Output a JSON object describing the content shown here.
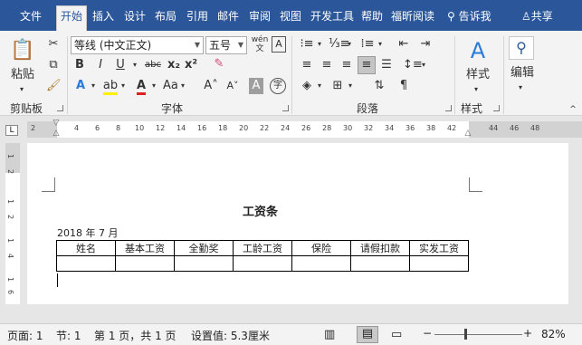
{
  "tabs": [
    {
      "label": "文件",
      "active": false
    },
    {
      "label": "开始",
      "active": true
    },
    {
      "label": "插入",
      "active": false
    },
    {
      "label": "设计",
      "active": false
    },
    {
      "label": "布局",
      "active": false
    },
    {
      "label": "引用",
      "active": false
    },
    {
      "label": "邮件",
      "active": false
    },
    {
      "label": "审阅",
      "active": false
    },
    {
      "label": "视图",
      "active": false
    },
    {
      "label": "开发工具",
      "active": false
    },
    {
      "label": "帮助",
      "active": false
    },
    {
      "label": "福昕阅读",
      "active": false
    }
  ],
  "tell_me": "告诉我",
  "share": "共享",
  "ribbon": {
    "clipboard": {
      "paste": "粘贴",
      "group": "剪贴板"
    },
    "font": {
      "family": "等线 (中文正文)",
      "size": "五号",
      "group": "字体",
      "wen_icon": "wén 文"
    },
    "paragraph": {
      "group": "段落"
    },
    "styles": {
      "label": "样式",
      "group": "样式"
    },
    "editing": {
      "label": "编辑"
    }
  },
  "ruler": {
    "corner": "L",
    "ticks": [
      "2",
      "2",
      "4",
      "6",
      "8",
      "10",
      "12",
      "14",
      "16",
      "18",
      "20",
      "22",
      "24",
      "26",
      "28",
      "30",
      "32",
      "34",
      "36",
      "38",
      "42",
      "44",
      "46",
      "48"
    ],
    "vticks": [
      "1",
      "2",
      "1",
      "2",
      "1",
      "4",
      "1",
      "6",
      "1"
    ]
  },
  "document": {
    "title": "工资条",
    "date": "2018 年 7 月",
    "table": {
      "headers": [
        "姓名",
        "基本工资",
        "全勤奖",
        "工龄工资",
        "保险",
        "请假扣款",
        "实发工资"
      ]
    }
  },
  "status": {
    "page": "页面: 1",
    "section": "节: 1",
    "pages": "第 1 页，共 1 页",
    "setting": "设置值: 5.3厘米",
    "zoom": "82%"
  }
}
